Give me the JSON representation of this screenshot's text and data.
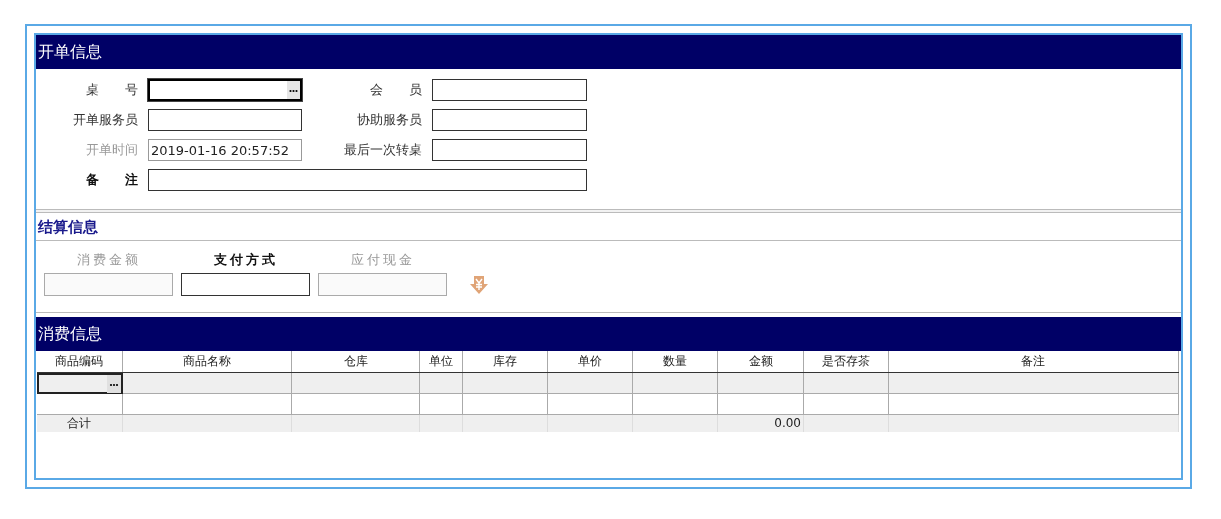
{
  "order_section": {
    "title": "开单信息",
    "fields": [
      {
        "label": "桌　　号",
        "disabled": false,
        "bold": false,
        "browse": true
      },
      {
        "label": "会　　员",
        "disabled": false,
        "bold": false
      },
      {
        "label": "开单服务员",
        "disabled": false,
        "bold": false
      },
      {
        "label": "协助服务员",
        "disabled": false,
        "bold": false
      },
      {
        "label": "开单时间",
        "value": "2019-01-16 20:57:52",
        "disabled": true,
        "bold": false
      },
      {
        "label": "最后一次转桌",
        "disabled": false,
        "bold": false
      },
      {
        "label": "备　　注",
        "disabled": false,
        "bold": true,
        "wide": true
      }
    ]
  },
  "payment_section": {
    "title": "结算信息",
    "fields": [
      {
        "label": "消费金额",
        "disabled": true,
        "bold": false
      },
      {
        "label": "支付方式",
        "disabled": false,
        "bold": true
      },
      {
        "label": "应付现金",
        "disabled": true,
        "bold": false
      }
    ]
  },
  "items_section": {
    "title": "消费信息",
    "table": {
      "columns": [
        {
          "label": "商品编码",
          "total": "合计"
        },
        {
          "label": "商品名称"
        },
        {
          "label": "仓库"
        },
        {
          "label": "单位"
        },
        {
          "label": "库存"
        },
        {
          "label": "单价"
        },
        {
          "label": "数量"
        },
        {
          "label": "金额",
          "total": "0.00"
        },
        {
          "label": "是否存茶"
        },
        {
          "label": "备注"
        }
      ],
      "rows": [
        {
          "selected": true
        },
        {
          "selected": false
        }
      ]
    }
  }
}
